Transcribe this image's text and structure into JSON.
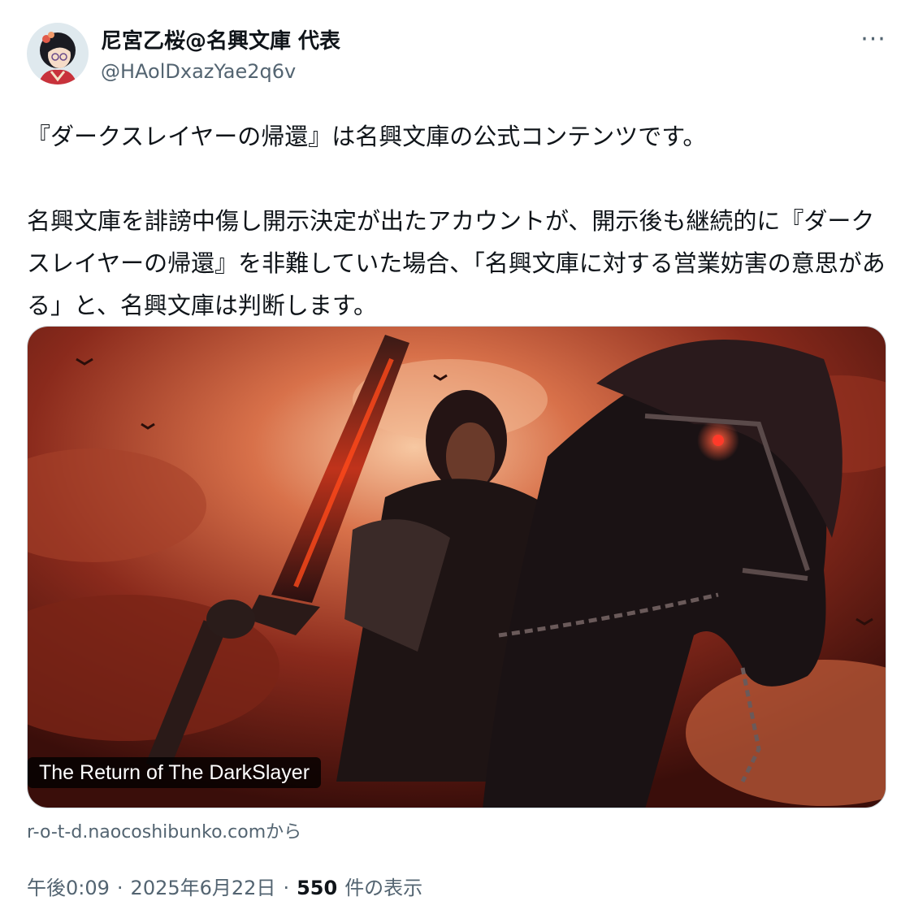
{
  "author": {
    "display_name": "尼宮乙桜@名興文庫 代表",
    "handle": "@HAolDxazYae2q6v",
    "avatar_icon": "avatar-image"
  },
  "menu": {
    "more_label": "···"
  },
  "tweet": {
    "paragraph_1": "『ダークスレイヤーの帰還』は名興文庫の公式コンテンツです。",
    "paragraph_2": "名興文庫を誹謗中傷し開示決定が出たアカウントが、開示後も継続的に『ダークスレイヤーの帰還』を非難していた場合、「名興文庫に対する営業妨害の意思がある」と、名興文庫は判断します。"
  },
  "card": {
    "title": "The Return of The DarkSlayer",
    "domain": "r-o-t-d.naocoshibunko.comから",
    "image_icon": "dark-knight-on-horse-image"
  },
  "meta": {
    "time": "午後0:09",
    "separator": "·",
    "date": "2025年6月22日",
    "views_count": "550",
    "views_label": "件の表示"
  },
  "colors": {
    "text": "#0f1419",
    "secondary": "#536471",
    "border": "#cfd9de"
  }
}
